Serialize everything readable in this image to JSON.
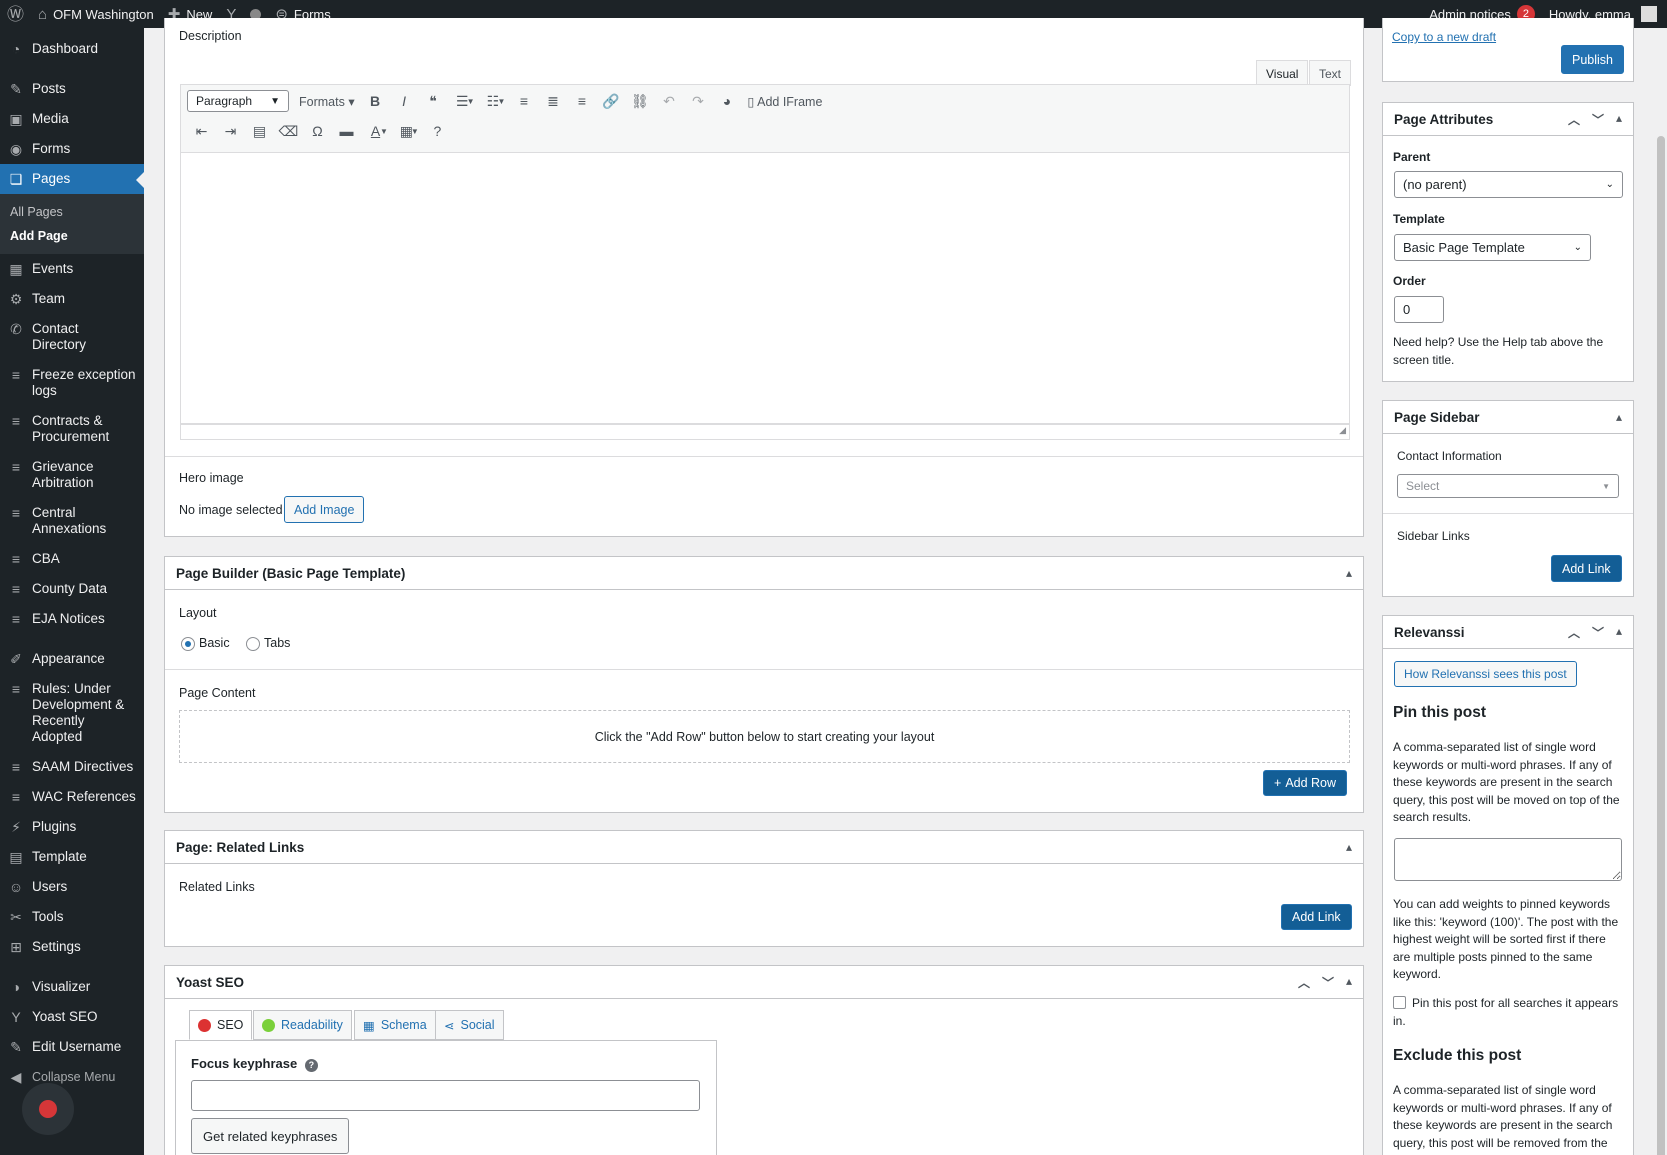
{
  "adminbar": {
    "wp_icon": "wordpress-icon",
    "site": "OFM Washington",
    "new": "New",
    "forms": "Forms",
    "notices": "Admin notices",
    "notice_count": "2",
    "howdy": "Howdy, emma"
  },
  "sidebar": {
    "items": [
      {
        "label": "Dashboard",
        "icon": "dashboard-icon",
        "glyph": "◔"
      },
      {
        "label": "Posts",
        "icon": "pin-icon",
        "glyph": "✎"
      },
      {
        "label": "Media",
        "icon": "media-icon",
        "glyph": "▣"
      },
      {
        "label": "Forms",
        "icon": "forms-icon",
        "glyph": "◉"
      },
      {
        "label": "Pages",
        "icon": "pages-icon",
        "glyph": "❏"
      },
      {
        "label": "Events",
        "icon": "calendar-icon",
        "glyph": "▦"
      },
      {
        "label": "Team",
        "icon": "team-icon",
        "glyph": "⚙"
      },
      {
        "label": "Contact Directory",
        "icon": "contact-icon",
        "glyph": "✆"
      },
      {
        "label": "Freeze exception logs",
        "icon": "database-icon",
        "glyph": "≡"
      },
      {
        "label": "Contracts & Procurement",
        "icon": "database-icon",
        "glyph": "≡"
      },
      {
        "label": "Grievance Arbitration",
        "icon": "database-icon",
        "glyph": "≡"
      },
      {
        "label": "Central Annexations",
        "icon": "database-icon",
        "glyph": "≡"
      },
      {
        "label": "CBA",
        "icon": "database-icon",
        "glyph": "≡"
      },
      {
        "label": "County Data",
        "icon": "database-icon",
        "glyph": "≡"
      },
      {
        "label": "EJA Notices",
        "icon": "database-icon",
        "glyph": "≡"
      },
      {
        "label": "Appearance",
        "icon": "brush-icon",
        "glyph": "✐"
      },
      {
        "label": "Rules: Under Development & Recently Adopted",
        "icon": "database-icon",
        "glyph": "≡"
      },
      {
        "label": "SAAM Directives",
        "icon": "database-icon",
        "glyph": "≡"
      },
      {
        "label": "WAC References",
        "icon": "database-icon",
        "glyph": "≡"
      },
      {
        "label": "Plugins",
        "icon": "plugin-icon",
        "glyph": "⚡"
      },
      {
        "label": "Template",
        "icon": "template-icon",
        "glyph": "▤"
      },
      {
        "label": "Users",
        "icon": "users-icon",
        "glyph": "☺"
      },
      {
        "label": "Tools",
        "icon": "tools-icon",
        "glyph": "✂"
      },
      {
        "label": "Settings",
        "icon": "settings-icon",
        "glyph": "⊞"
      },
      {
        "label": "Visualizer",
        "icon": "visualizer-icon",
        "glyph": "◑"
      },
      {
        "label": "Yoast SEO",
        "icon": "yoast-icon",
        "glyph": "Y"
      },
      {
        "label": "Edit Username",
        "icon": "edit-icon",
        "glyph": "✎"
      }
    ],
    "submenu": [
      "All Pages",
      "Add Page"
    ],
    "collapse": "Collapse Menu"
  },
  "description": {
    "label": "Description",
    "tab_visual": "Visual",
    "tab_text": "Text",
    "paragraph": "Paragraph",
    "formats": "Formats",
    "add_iframe": "Add IFrame"
  },
  "hero": {
    "label": "Hero image",
    "no_image": "No image selected",
    "add_image": "Add Image"
  },
  "page_builder": {
    "title": "Page Builder (Basic Page Template)",
    "layout_label": "Layout",
    "basic": "Basic",
    "tabs": "Tabs",
    "content_label": "Page Content",
    "placeholder": "Click the \"Add Row\" button below to start creating your layout",
    "add_row": "Add Row"
  },
  "related": {
    "title": "Page: Related Links",
    "label": "Related Links",
    "add_link": "Add Link"
  },
  "yoast": {
    "title": "Yoast SEO",
    "tabs": [
      "SEO",
      "Readability",
      "Schema",
      "Social"
    ],
    "focus_label": "Focus keyphrase",
    "related_btn": "Get related keyphrases",
    "seo_color": "#dc3232",
    "readability_color": "#7ad03a"
  },
  "publish": {
    "copy_draft": "Copy to a new draft",
    "publish": "Publish"
  },
  "attributes": {
    "title": "Page Attributes",
    "parent_label": "Parent",
    "parent_value": "(no parent)",
    "template_label": "Template",
    "template_value": "Basic Page Template",
    "order_label": "Order",
    "order_value": "0",
    "help": "Need help? Use the Help tab above the screen title."
  },
  "page_sidebar": {
    "title": "Page Sidebar",
    "contact_label": "Contact Information",
    "select_placeholder": "Select",
    "links_label": "Sidebar Links",
    "add_link": "Add Link"
  },
  "relevanssi": {
    "title": "Relevanssi",
    "how_btn": "How Relevanssi sees this post",
    "pin_heading": "Pin this post",
    "pin_text": "A comma-separated list of single word keywords or multi-word phrases. If any of these keywords are present in the search query, this post will be moved on top of the search results.",
    "weights_text": "You can add weights to pinned keywords like this: 'keyword (100)'. The post with the highest weight will be sorted first if there are multiple posts pinned to the same keyword.",
    "pin_all": "Pin this post for all searches it appears in.",
    "exclude_heading": "Exclude this post",
    "exclude_text": "A comma-separated list of single word keywords or multi-word phrases. If any of these keywords are present in the search query, this post will be removed from the"
  }
}
